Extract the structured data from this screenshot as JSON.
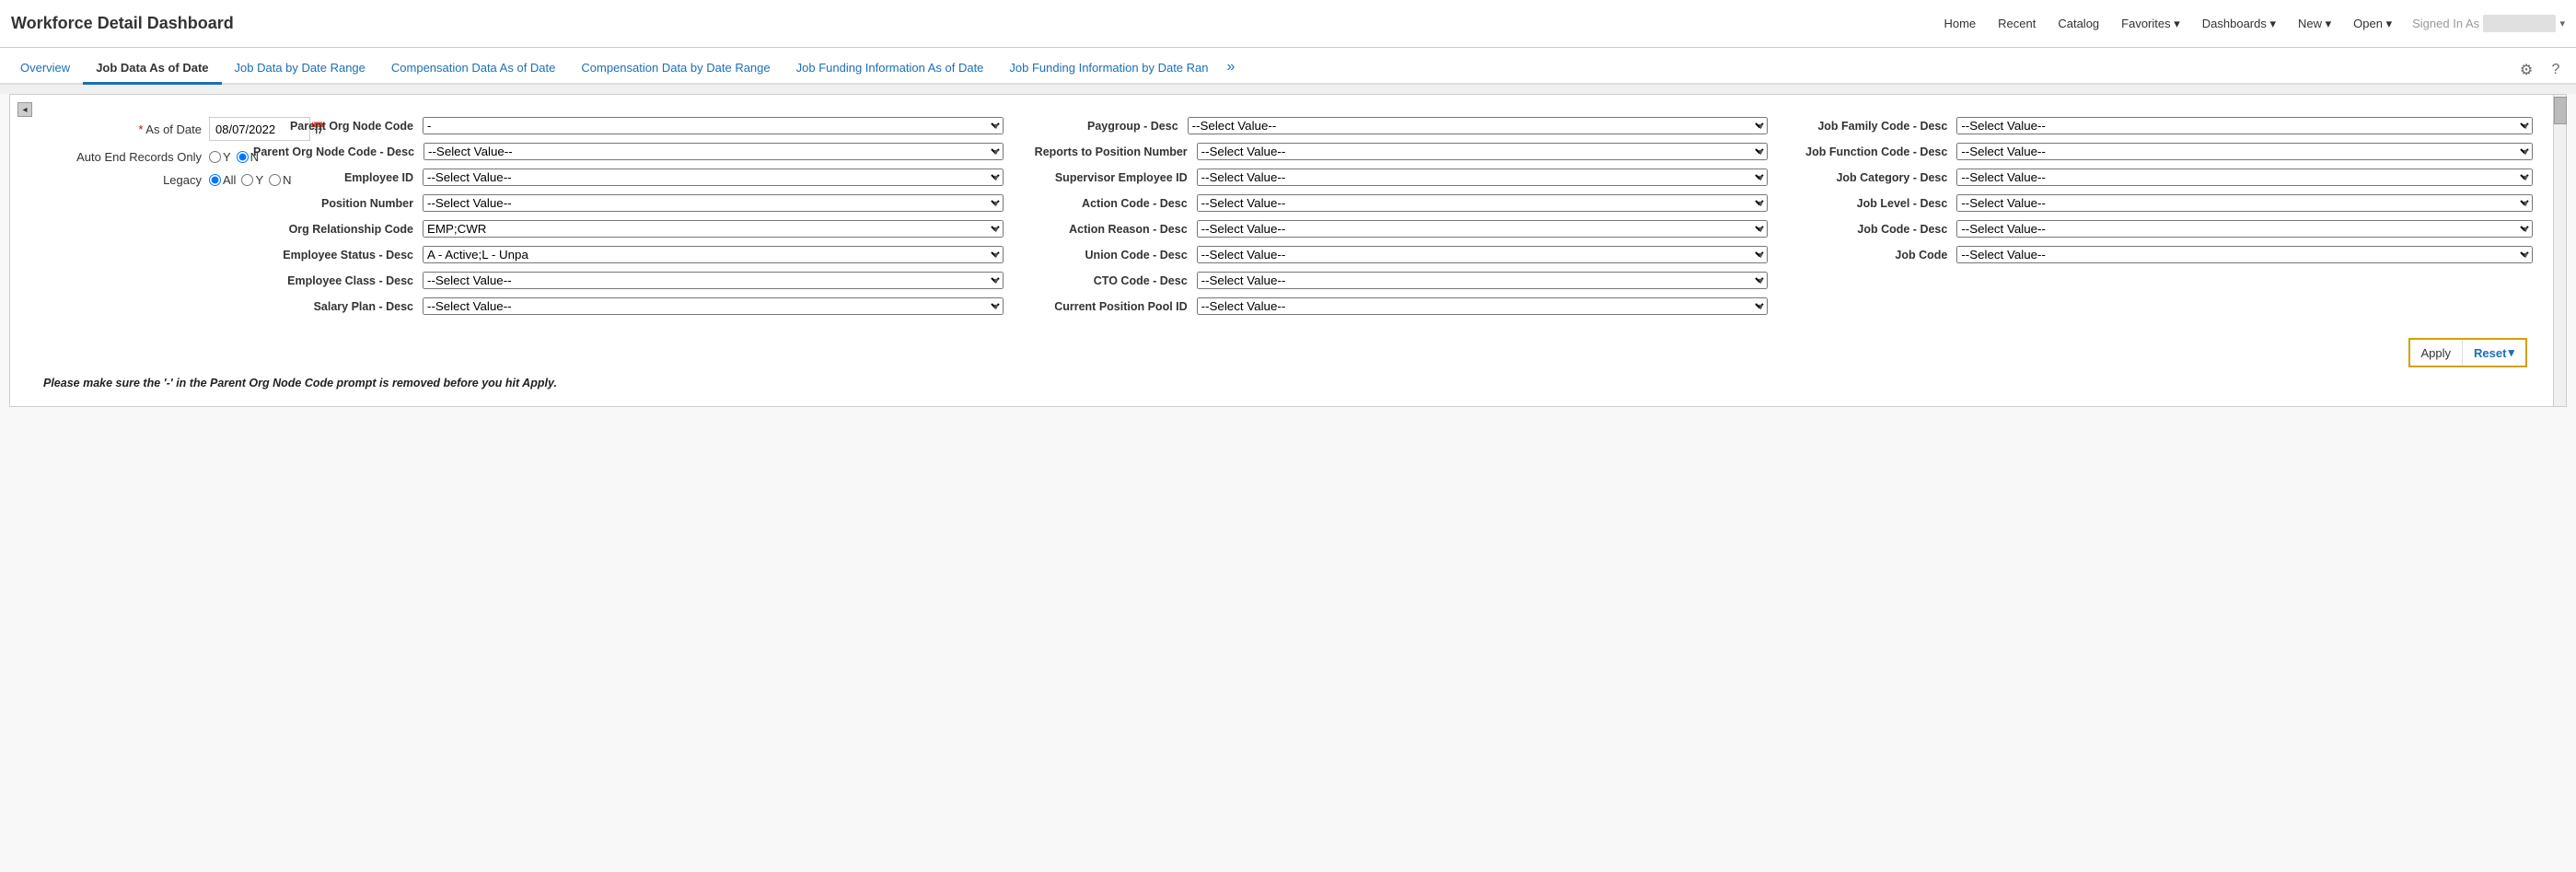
{
  "app": {
    "title": "Workforce Detail Dashboard"
  },
  "topnav": {
    "items": [
      {
        "label": "Home",
        "has_arrow": false
      },
      {
        "label": "Recent",
        "has_arrow": false
      },
      {
        "label": "Catalog",
        "has_arrow": false
      },
      {
        "label": "Favorites",
        "has_arrow": true
      },
      {
        "label": "Dashboards",
        "has_arrow": true
      },
      {
        "label": "New",
        "has_arrow": true
      },
      {
        "label": "Open",
        "has_arrow": true
      }
    ],
    "signed_in_label": "Signed In As",
    "signed_in_user": ""
  },
  "tabs": [
    {
      "label": "Overview",
      "active": false
    },
    {
      "label": "Job Data As of Date",
      "active": true
    },
    {
      "label": "Job Data by Date Range",
      "active": false
    },
    {
      "label": "Compensation Data As of Date",
      "active": false
    },
    {
      "label": "Compensation Data by Date Range",
      "active": false
    },
    {
      "label": "Job Funding Information As of Date",
      "active": false
    },
    {
      "label": "Job Funding Information by Date Ran ›",
      "active": false
    }
  ],
  "filters": {
    "as_of_date": {
      "label": "* As of Date",
      "value": "08/07/2022"
    },
    "auto_end_records_only": {
      "label": "Auto End Records Only",
      "options": [
        {
          "label": "Y",
          "value": "Y",
          "checked": false
        },
        {
          "label": "N",
          "value": "N",
          "checked": true
        }
      ]
    },
    "legacy": {
      "label": "Legacy",
      "options": [
        {
          "label": "All",
          "value": "All",
          "checked": true
        },
        {
          "label": "Y",
          "value": "Y",
          "checked": false
        },
        {
          "label": "N",
          "value": "N",
          "checked": false
        }
      ]
    },
    "col2": [
      {
        "label": "Parent Org Node Code",
        "value": "-",
        "type": "select_dash"
      },
      {
        "label": "Parent Org Node Code - Desc",
        "value": "--Select Value--",
        "type": "select"
      },
      {
        "label": "Employee ID",
        "value": "--Select Value--",
        "type": "select"
      },
      {
        "label": "Position Number",
        "value": "--Select Value--",
        "type": "select"
      },
      {
        "label": "Org Relationship Code",
        "value": "EMP;CWR",
        "type": "select"
      },
      {
        "label": "Employee Status - Desc",
        "value": "A - Active;L - Unpa",
        "type": "select"
      },
      {
        "label": "Employee Class - Desc",
        "value": "--Select Value--",
        "type": "select"
      },
      {
        "label": "Salary Plan - Desc",
        "value": "--Select Value--",
        "type": "select"
      }
    ],
    "col3": [
      {
        "label": "Paygroup - Desc",
        "value": "--Select Value--",
        "type": "select"
      },
      {
        "label": "Reports to Position Number",
        "value": "--Select Value--",
        "type": "select"
      },
      {
        "label": "Supervisor Employee ID",
        "value": "--Select Value--",
        "type": "select"
      },
      {
        "label": "Action Code - Desc",
        "value": "--Select Value--",
        "type": "select"
      },
      {
        "label": "Action Reason - Desc",
        "value": "--Select Value--",
        "type": "select"
      },
      {
        "label": "Union Code - Desc",
        "value": "--Select Value--",
        "type": "select"
      },
      {
        "label": "CTO Code - Desc",
        "value": "--Select Value--",
        "type": "select"
      },
      {
        "label": "Current Position Pool ID",
        "value": "--Select Value--",
        "type": "select"
      }
    ],
    "col4": [
      {
        "label": "Job Family Code - Desc",
        "value": "--Select Value--",
        "type": "select"
      },
      {
        "label": "Job Function Code - Desc",
        "value": "--Select Value--",
        "type": "select"
      },
      {
        "label": "Job Category - Desc",
        "value": "--Select Value--",
        "type": "select"
      },
      {
        "label": "Job Level - Desc",
        "value": "--Select Value--",
        "type": "select"
      },
      {
        "label": "Job Code - Desc",
        "value": "--Select Value--",
        "type": "select"
      },
      {
        "label": "Job Code",
        "value": "--Select Value--",
        "type": "select"
      }
    ]
  },
  "actions": {
    "apply_label": "Apply",
    "reset_label": "Reset"
  },
  "warning": {
    "message": "Please make sure the '-' in the Parent Org Node Code prompt is removed before you hit Apply."
  }
}
